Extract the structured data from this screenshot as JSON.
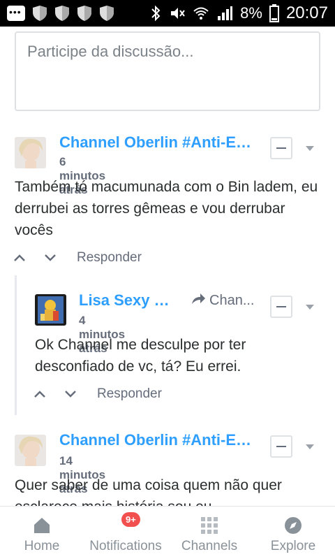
{
  "status_bar": {
    "battery": "8%",
    "time": "20:07"
  },
  "compose": {
    "placeholder": "Participe da discussão..."
  },
  "comments": [
    {
      "author": "Channel Oberlin #Anti-Est...",
      "time": "6 minutos atrás",
      "body": "Também tó macumunada com o Bin ladem, eu derrubei as torres gêmeas e vou derrubar vocês",
      "reply_label": "Responder"
    },
    {
      "author": "Lisa Sexy 💋 💋",
      "reply_to": "Chan...",
      "time": "4 minutos atrás",
      "body": "Ok Channel me desculpe por ter desconfiado de vc, tá? Eu errei.",
      "reply_label": "Responder"
    },
    {
      "author": "Channel Oberlin #Anti-Est...",
      "time": "14 minutos atrás",
      "body": "Quer saber de uma coisa quem não quer esclarece mais história sou eu"
    }
  ],
  "bottom_nav": {
    "items": [
      {
        "label": "Home",
        "icon": "home-icon"
      },
      {
        "label": "Notifications",
        "icon": "notifications-icon",
        "badge": "9+"
      },
      {
        "label": "Channels",
        "icon": "channels-icon"
      },
      {
        "label": "Explore",
        "icon": "explore-icon"
      }
    ]
  },
  "colors": {
    "accent": "#2e9fff",
    "text": "#2a2e2e",
    "muted": "#656c7a",
    "badge": "#f24f4f"
  }
}
